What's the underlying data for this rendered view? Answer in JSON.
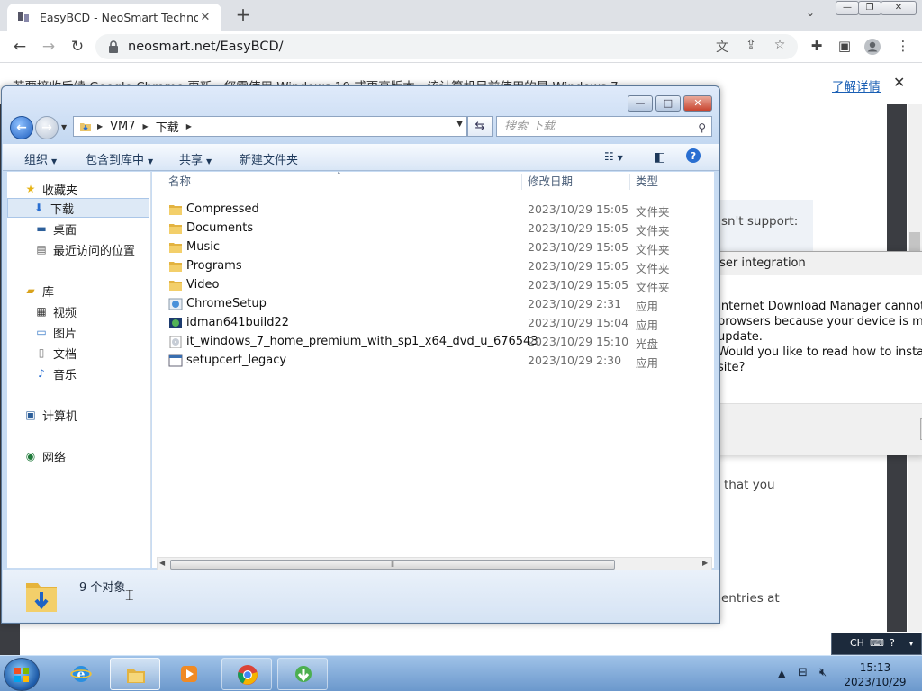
{
  "browser": {
    "tab_title": "EasyBCD - NeoSmart Technolo",
    "tab_close": "✕",
    "new_tab": "+",
    "url": "neosmart.net/EasyBCD/",
    "window_controls": {
      "min": "—",
      "restore": "❐",
      "close": "✕"
    },
    "infobar": {
      "message": "若要接收后续 Google Chrome 更新，您需使用 Windows 10 或更高版本。该计算机目前使用的是 Windows 7。",
      "link": "了解详情",
      "close": "✕"
    }
  },
  "page": {
    "fragments": [
      "sn't support:",
      "that you",
      "entries at"
    ]
  },
  "explorer": {
    "breadcrumb": [
      "VM7",
      "下载"
    ],
    "search_placeholder": "搜索 下载",
    "commands": {
      "organize": "组织",
      "include_library": "包含到库中",
      "share": "共享",
      "new_folder": "新建文件夹"
    },
    "nav": {
      "favorites": "收藏夹",
      "downloads": "下载",
      "desktop": "桌面",
      "recent": "最近访问的位置",
      "libraries": "库",
      "videos": "视频",
      "pictures": "图片",
      "documents": "文档",
      "music": "音乐",
      "computer": "计算机",
      "network": "网络"
    },
    "columns": {
      "name": "名称",
      "date": "修改日期",
      "type": "类型"
    },
    "files": [
      {
        "name": "Compressed",
        "date": "2023/10/29 15:05",
        "type": "文件夹",
        "icon": "folder"
      },
      {
        "name": "Documents",
        "date": "2023/10/29 15:05",
        "type": "文件夹",
        "icon": "folder"
      },
      {
        "name": "Music",
        "date": "2023/10/29 15:05",
        "type": "文件夹",
        "icon": "folder"
      },
      {
        "name": "Programs",
        "date": "2023/10/29 15:05",
        "type": "文件夹",
        "icon": "folder"
      },
      {
        "name": "Video",
        "date": "2023/10/29 15:05",
        "type": "文件夹",
        "icon": "folder"
      },
      {
        "name": "ChromeSetup",
        "date": "2023/10/29 2:31",
        "type": "应用",
        "icon": "setup"
      },
      {
        "name": "idman641build22",
        "date": "2023/10/29 15:04",
        "type": "应用",
        "icon": "idm"
      },
      {
        "name": "it_windows_7_home_premium_with_sp1_x64_dvd_u_676543",
        "date": "2023/10/29 15:10",
        "type": "光盘",
        "icon": "iso"
      },
      {
        "name": "setupcert_legacy",
        "date": "2023/10/29 2:30",
        "type": "应用",
        "icon": "app"
      }
    ],
    "status_count": "9 个对象"
  },
  "idm_dialog": {
    "title": "IDM browser integration",
    "message": "Internet Download Manager cannot tur\nbrowsers because your device is missin\nupdate.\nWould you like to read how to install th\nsite?"
  },
  "taskbar": {
    "time": "15:13",
    "date": "2023/10/29",
    "lang": "CH"
  },
  "colors": {
    "explorer_frame": "#c8dcf3",
    "taskbar": "#6b98cc",
    "link": "#1a5fb4",
    "selection": "#dde9f6"
  }
}
